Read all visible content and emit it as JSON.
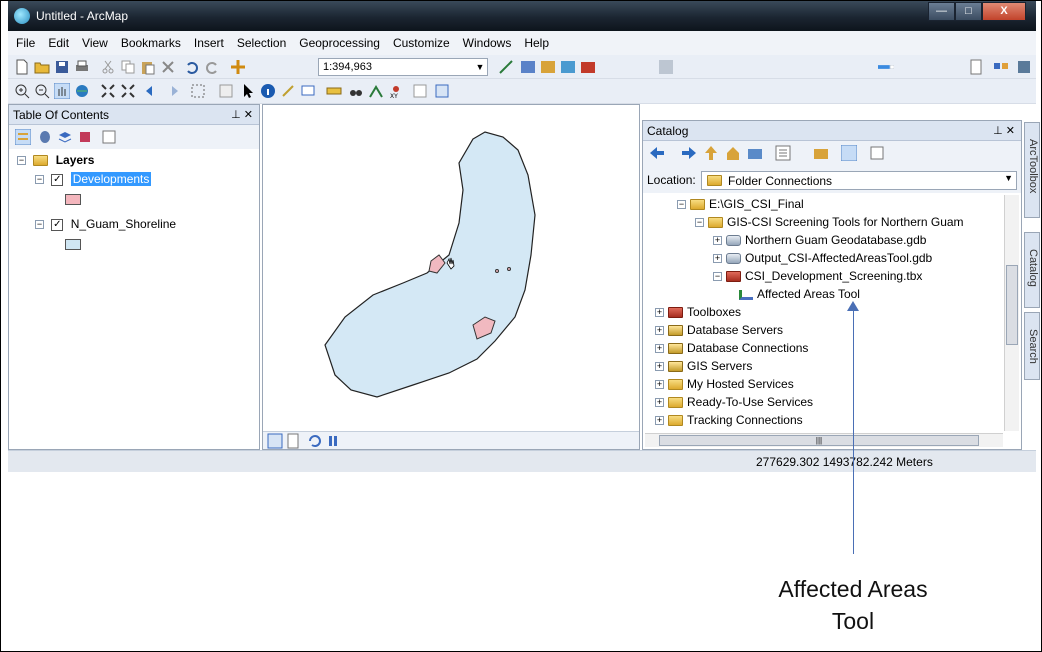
{
  "window": {
    "title": "Untitled - ArcMap",
    "min": "—",
    "max": "□",
    "close": "X"
  },
  "menu": [
    "File",
    "Edit",
    "View",
    "Bookmarks",
    "Insert",
    "Selection",
    "Geoprocessing",
    "Customize",
    "Windows",
    "Help"
  ],
  "toolbar": {
    "scale": "1:394,963"
  },
  "toc": {
    "title": "Table Of Contents",
    "root": "Layers",
    "layers": [
      {
        "name": "Developments",
        "checked": true,
        "color": "#f4b6bd"
      },
      {
        "name": "N_Guam_Shoreline",
        "checked": true,
        "color": "#cfe6f3"
      }
    ]
  },
  "map": {
    "land_color": "#d4e8f5",
    "development_color": "#f1b9c0"
  },
  "catalog": {
    "title": "Catalog",
    "location_label": "Location:",
    "location_value": "Folder Connections",
    "tree": [
      {
        "label": "E:\\GIS_CSI_Final",
        "icon": "folder",
        "expander": "−",
        "level": 1
      },
      {
        "label": "GIS-CSI Screening Tools for Northern Guam",
        "icon": "folder",
        "expander": "−",
        "level": 2
      },
      {
        "label": "Northern Guam Geodatabase.gdb",
        "icon": "gdb",
        "expander": "+",
        "level": 3
      },
      {
        "label": "Output_CSI-AffectedAreasTool.gdb",
        "icon": "gdb",
        "expander": "+",
        "level": 3
      },
      {
        "label": "CSI_Development_Screening.tbx",
        "icon": "tbx",
        "expander": "−",
        "level": 3
      },
      {
        "label": "Affected Areas Tool",
        "icon": "tool",
        "expander": "",
        "level": 4
      },
      {
        "label": "Toolboxes",
        "icon": "tbx",
        "expander": "+",
        "level": 0
      },
      {
        "label": "Database Servers",
        "icon": "srv",
        "expander": "+",
        "level": 0
      },
      {
        "label": "Database Connections",
        "icon": "srv",
        "expander": "+",
        "level": 0
      },
      {
        "label": "GIS Servers",
        "icon": "srv",
        "expander": "+",
        "level": 0
      },
      {
        "label": "My Hosted Services",
        "icon": "folder",
        "expander": "+",
        "level": 0
      },
      {
        "label": "Ready-To-Use Services",
        "icon": "folder",
        "expander": "+",
        "level": 0
      },
      {
        "label": "Tracking Connections",
        "icon": "folder",
        "expander": "+",
        "level": 0
      }
    ]
  },
  "sidetabs": [
    "ArcToolbox",
    "Catalog",
    "Search"
  ],
  "status": {
    "coordinates": "277629.302  1493782.242 Meters"
  },
  "callout": {
    "line1": "Affected Areas",
    "line2": "Tool"
  }
}
